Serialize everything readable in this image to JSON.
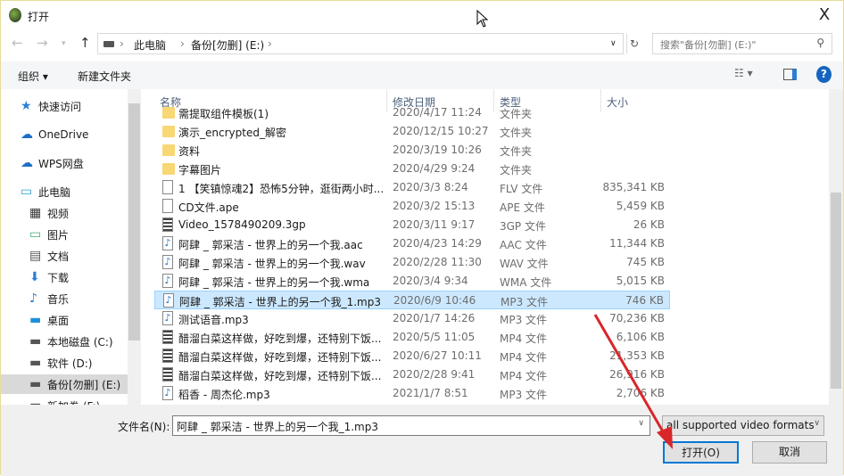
{
  "window": {
    "title": "打开",
    "close": "X"
  },
  "address": {
    "crumbs": [
      "此电脑",
      "备份[勿删] (E:)"
    ],
    "search_placeholder": "搜索\"备份[勿删] (E:)\""
  },
  "toolbar": {
    "organize": "组织 ▾",
    "new_folder": "新建文件夹"
  },
  "nav": [
    {
      "label": "快速访问",
      "icon": "star-icon"
    },
    {
      "label": "OneDrive",
      "icon": "cloud-icon"
    },
    {
      "label": "WPS网盘",
      "icon": "cloud-icon"
    },
    {
      "label": "此电脑",
      "icon": "computer-icon"
    },
    {
      "label": "视频",
      "icon": "video-folder-icon"
    },
    {
      "label": "图片",
      "icon": "pictures-icon"
    },
    {
      "label": "文档",
      "icon": "documents-icon"
    },
    {
      "label": "下载",
      "icon": "download-icon"
    },
    {
      "label": "音乐",
      "icon": "music-icon"
    },
    {
      "label": "桌面",
      "icon": "desktop-icon"
    },
    {
      "label": "本地磁盘 (C:)",
      "icon": "drive-icon"
    },
    {
      "label": "软件 (D:)",
      "icon": "drive-icon"
    },
    {
      "label": "备份[勿删] (E:)",
      "icon": "drive-icon",
      "selected": true
    },
    {
      "label": "新加卷 (F:)",
      "icon": "drive-icon"
    }
  ],
  "columns": {
    "name": "名称",
    "date": "修改日期",
    "type": "类型",
    "size": "大小"
  },
  "files": [
    {
      "name": "需提取组件模板(1)",
      "date": "2020/4/17 11:24",
      "type": "文件夹",
      "size": "",
      "icon": "folder"
    },
    {
      "name": "演示_encrypted_解密",
      "date": "2020/12/15 10:27",
      "type": "文件夹",
      "size": "",
      "icon": "folder"
    },
    {
      "name": "资料",
      "date": "2020/3/19 10:26",
      "type": "文件夹",
      "size": "",
      "icon": "folder"
    },
    {
      "name": "字幕图片",
      "date": "2020/4/29 9:24",
      "type": "文件夹",
      "size": "",
      "icon": "folder"
    },
    {
      "name": "1 【笑镇惊魂2】恐怖5分钟，逛街两小时...",
      "date": "2020/3/3 8:24",
      "type": "FLV 文件",
      "size": "835,341 KB",
      "icon": "doc"
    },
    {
      "name": "CD文件.ape",
      "date": "2020/3/2 15:13",
      "type": "APE 文件",
      "size": "5,459 KB",
      "icon": "doc"
    },
    {
      "name": "Video_1578490209.3gp",
      "date": "2020/3/11 9:17",
      "type": "3GP 文件",
      "size": "26 KB",
      "icon": "video"
    },
    {
      "name": "阿肆 _ 郭采洁 - 世界上的另一个我.aac",
      "date": "2020/4/23 14:29",
      "type": "AAC 文件",
      "size": "11,344 KB",
      "icon": "music"
    },
    {
      "name": "阿肆 _ 郭采洁 - 世界上的另一个我.wav",
      "date": "2020/2/28 11:30",
      "type": "WAV 文件",
      "size": "745 KB",
      "icon": "music"
    },
    {
      "name": "阿肆 _ 郭采洁 - 世界上的另一个我.wma",
      "date": "2020/3/4 9:34",
      "type": "WMA 文件",
      "size": "5,015 KB",
      "icon": "music"
    },
    {
      "name": "阿肆 _ 郭采洁 - 世界上的另一个我_1.mp3",
      "date": "2020/6/9 10:46",
      "type": "MP3 文件",
      "size": "746 KB",
      "icon": "music",
      "selected": true
    },
    {
      "name": "测试语音.mp3",
      "date": "2020/1/7 14:26",
      "type": "MP3 文件",
      "size": "70,236 KB",
      "icon": "music"
    },
    {
      "name": "醋溜白菜这样做，好吃到爆，还特别下饭...",
      "date": "2020/5/5 11:05",
      "type": "MP4 文件",
      "size": "6,106 KB",
      "icon": "video"
    },
    {
      "name": "醋溜白菜这样做，好吃到爆，还特别下饭...",
      "date": "2020/6/27 10:11",
      "type": "MP4 文件",
      "size": "21,353 KB",
      "icon": "video"
    },
    {
      "name": "醋溜白菜这样做，好吃到爆，还特别下饭...",
      "date": "2020/2/28 9:41",
      "type": "MP4 文件",
      "size": "26,916 KB",
      "icon": "video"
    },
    {
      "name": "稻香 - 周杰伦.mp3",
      "date": "2021/1/7 8:51",
      "type": "MP3 文件",
      "size": "2,706 KB",
      "icon": "music"
    }
  ],
  "bottom": {
    "filename_label": "文件名(N):",
    "filename_value": "阿肆 _ 郭采洁 - 世界上的另一个我_1.mp3",
    "filter": "all supported video formats",
    "open": "打开(O)",
    "cancel": "取消"
  },
  "annotation_color": "#d9262a"
}
